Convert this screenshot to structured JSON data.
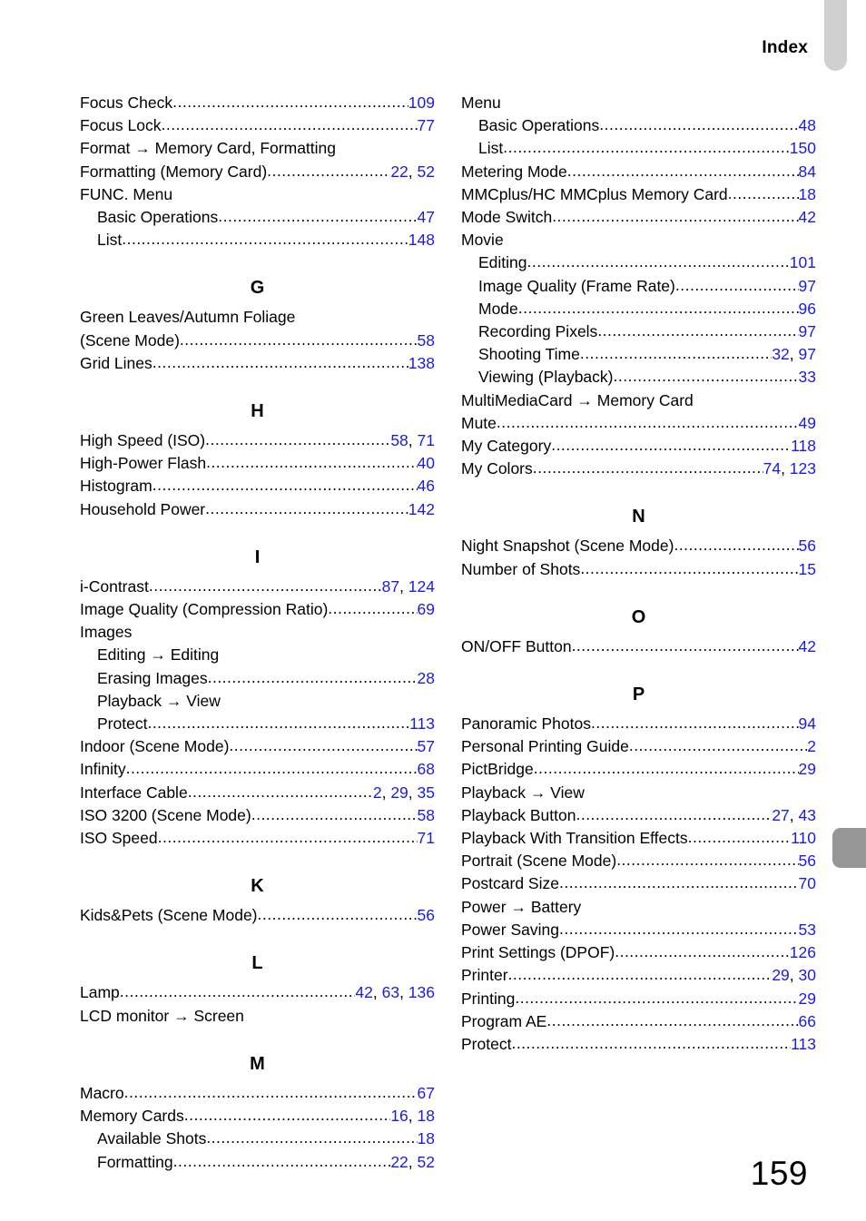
{
  "header": {
    "title": "Index"
  },
  "page_number": "159",
  "colors": {
    "page_link": "#1a1ae6",
    "tab_top": "#d0d0d0",
    "tab_section": "#969696",
    "text": "#000000"
  },
  "columns": [
    {
      "name": "left",
      "blocks": [
        {
          "heading": null,
          "entries": [
            {
              "label": "Focus Check",
              "pages": "109",
              "level": 0
            },
            {
              "label": "Focus Lock",
              "pages": "77",
              "level": 0
            },
            {
              "label": "Format → Memory Card, Formatting",
              "pages": null,
              "level": 0
            },
            {
              "label": "Formatting (Memory Card)",
              "pages": "22, 52",
              "level": 0
            },
            {
              "label": "FUNC. Menu",
              "pages": null,
              "level": 0
            },
            {
              "label": "Basic Operations",
              "pages": "47",
              "level": 1
            },
            {
              "label": "List",
              "pages": "148",
              "level": 1
            }
          ]
        },
        {
          "heading": "G",
          "entries": [
            {
              "label": "Green Leaves/Autumn Foliage",
              "pages": null,
              "level": 0
            },
            {
              "label": " (Scene Mode)",
              "pages": "58",
              "level": 0
            },
            {
              "label": "Grid Lines",
              "pages": "138",
              "level": 0
            }
          ]
        },
        {
          "heading": "H",
          "entries": [
            {
              "label": "High Speed (ISO)",
              "pages": "58, 71",
              "level": 0
            },
            {
              "label": "High-Power Flash",
              "pages": "40",
              "level": 0
            },
            {
              "label": "Histogram",
              "pages": "46",
              "level": 0
            },
            {
              "label": "Household Power",
              "pages": "142",
              "level": 0
            }
          ]
        },
        {
          "heading": "I",
          "entries": [
            {
              "label": "i-Contrast",
              "pages": "87, 124",
              "level": 0
            },
            {
              "label": "Image Quality (Compression Ratio)",
              "pages": "69",
              "level": 0
            },
            {
              "label": "Images",
              "pages": null,
              "level": 0
            },
            {
              "label": "Editing → Editing",
              "pages": null,
              "level": 1
            },
            {
              "label": "Erasing Images",
              "pages": "28",
              "level": 1
            },
            {
              "label": "Playback → View",
              "pages": null,
              "level": 1
            },
            {
              "label": "Protect",
              "pages": "113",
              "level": 1
            },
            {
              "label": "Indoor (Scene Mode)",
              "pages": "57",
              "level": 0
            },
            {
              "label": "Infinity",
              "pages": "68",
              "level": 0
            },
            {
              "label": "Interface Cable",
              "pages": "2, 29, 35",
              "level": 0
            },
            {
              "label": "ISO 3200 (Scene Mode)",
              "pages": "58",
              "level": 0
            },
            {
              "label": "ISO Speed",
              "pages": "71",
              "level": 0
            }
          ]
        },
        {
          "heading": "K",
          "entries": [
            {
              "label": "Kids&Pets (Scene Mode)",
              "pages": "56",
              "level": 0
            }
          ]
        },
        {
          "heading": "L",
          "entries": [
            {
              "label": "Lamp",
              "pages": "42, 63, 136",
              "level": 0
            },
            {
              "label": "LCD monitor → Screen",
              "pages": null,
              "level": 0
            }
          ]
        },
        {
          "heading": "M",
          "entries": [
            {
              "label": "Macro",
              "pages": "67",
              "level": 0
            },
            {
              "label": "Memory Cards",
              "pages": "16, 18",
              "level": 0
            },
            {
              "label": "Available Shots",
              "pages": "18",
              "level": 1
            },
            {
              "label": "Formatting",
              "pages": "22, 52",
              "level": 1
            }
          ]
        }
      ]
    },
    {
      "name": "right",
      "blocks": [
        {
          "heading": null,
          "entries": [
            {
              "label": "Menu",
              "pages": null,
              "level": 0
            },
            {
              "label": "Basic Operations",
              "pages": "48",
              "level": 1
            },
            {
              "label": "List",
              "pages": "150",
              "level": 1
            },
            {
              "label": "Metering Mode",
              "pages": "84",
              "level": 0
            },
            {
              "label": "MMCplus/HC MMCplus Memory Card",
              "pages": "18",
              "level": 0
            },
            {
              "label": "Mode Switch",
              "pages": "42",
              "level": 0
            },
            {
              "label": "Movie",
              "pages": null,
              "level": 0
            },
            {
              "label": "Editing",
              "pages": "101",
              "level": 1
            },
            {
              "label": "Image Quality (Frame Rate)",
              "pages": "97",
              "level": 1
            },
            {
              "label": "Mode",
              "pages": "96",
              "level": 1
            },
            {
              "label": "Recording Pixels",
              "pages": "97",
              "level": 1
            },
            {
              "label": "Shooting Time",
              "pages": "32, 97",
              "level": 1
            },
            {
              "label": "Viewing (Playback)",
              "pages": "33",
              "level": 1
            },
            {
              "label": "MultiMediaCard → Memory Card",
              "pages": null,
              "level": 0
            },
            {
              "label": "Mute",
              "pages": "49",
              "level": 0
            },
            {
              "label": "My Category",
              "pages": "118",
              "level": 0
            },
            {
              "label": "My Colors",
              "pages": "74, 123",
              "level": 0
            }
          ]
        },
        {
          "heading": "N",
          "entries": [
            {
              "label": "Night Snapshot (Scene Mode)",
              "pages": "56",
              "level": 0
            },
            {
              "label": "Number of Shots",
              "pages": "15",
              "level": 0
            }
          ]
        },
        {
          "heading": "O",
          "entries": [
            {
              "label": "ON/OFF Button",
              "pages": "42",
              "level": 0
            }
          ]
        },
        {
          "heading": "P",
          "entries": [
            {
              "label": "Panoramic Photos",
              "pages": "94",
              "level": 0
            },
            {
              "label": "Personal Printing Guide",
              "pages": "2",
              "level": 0
            },
            {
              "label": "PictBridge",
              "pages": "29",
              "level": 0
            },
            {
              "label": "Playback → View",
              "pages": null,
              "level": 0
            },
            {
              "label": "Playback Button",
              "pages": "27, 43",
              "level": 0
            },
            {
              "label": "Playback With Transition Effects",
              "pages": "110",
              "level": 0
            },
            {
              "label": "Portrait (Scene Mode)",
              "pages": "56",
              "level": 0
            },
            {
              "label": "Postcard Size",
              "pages": "70",
              "level": 0
            },
            {
              "label": "Power → Battery",
              "pages": null,
              "level": 0
            },
            {
              "label": "Power Saving",
              "pages": "53",
              "level": 0
            },
            {
              "label": "Print Settings (DPOF)",
              "pages": "126",
              "level": 0
            },
            {
              "label": "Printer",
              "pages": "29, 30",
              "level": 0
            },
            {
              "label": "Printing",
              "pages": "29",
              "level": 0
            },
            {
              "label": "Program AE",
              "pages": "66",
              "level": 0
            },
            {
              "label": "Protect",
              "pages": "113",
              "level": 0
            }
          ]
        }
      ]
    }
  ]
}
